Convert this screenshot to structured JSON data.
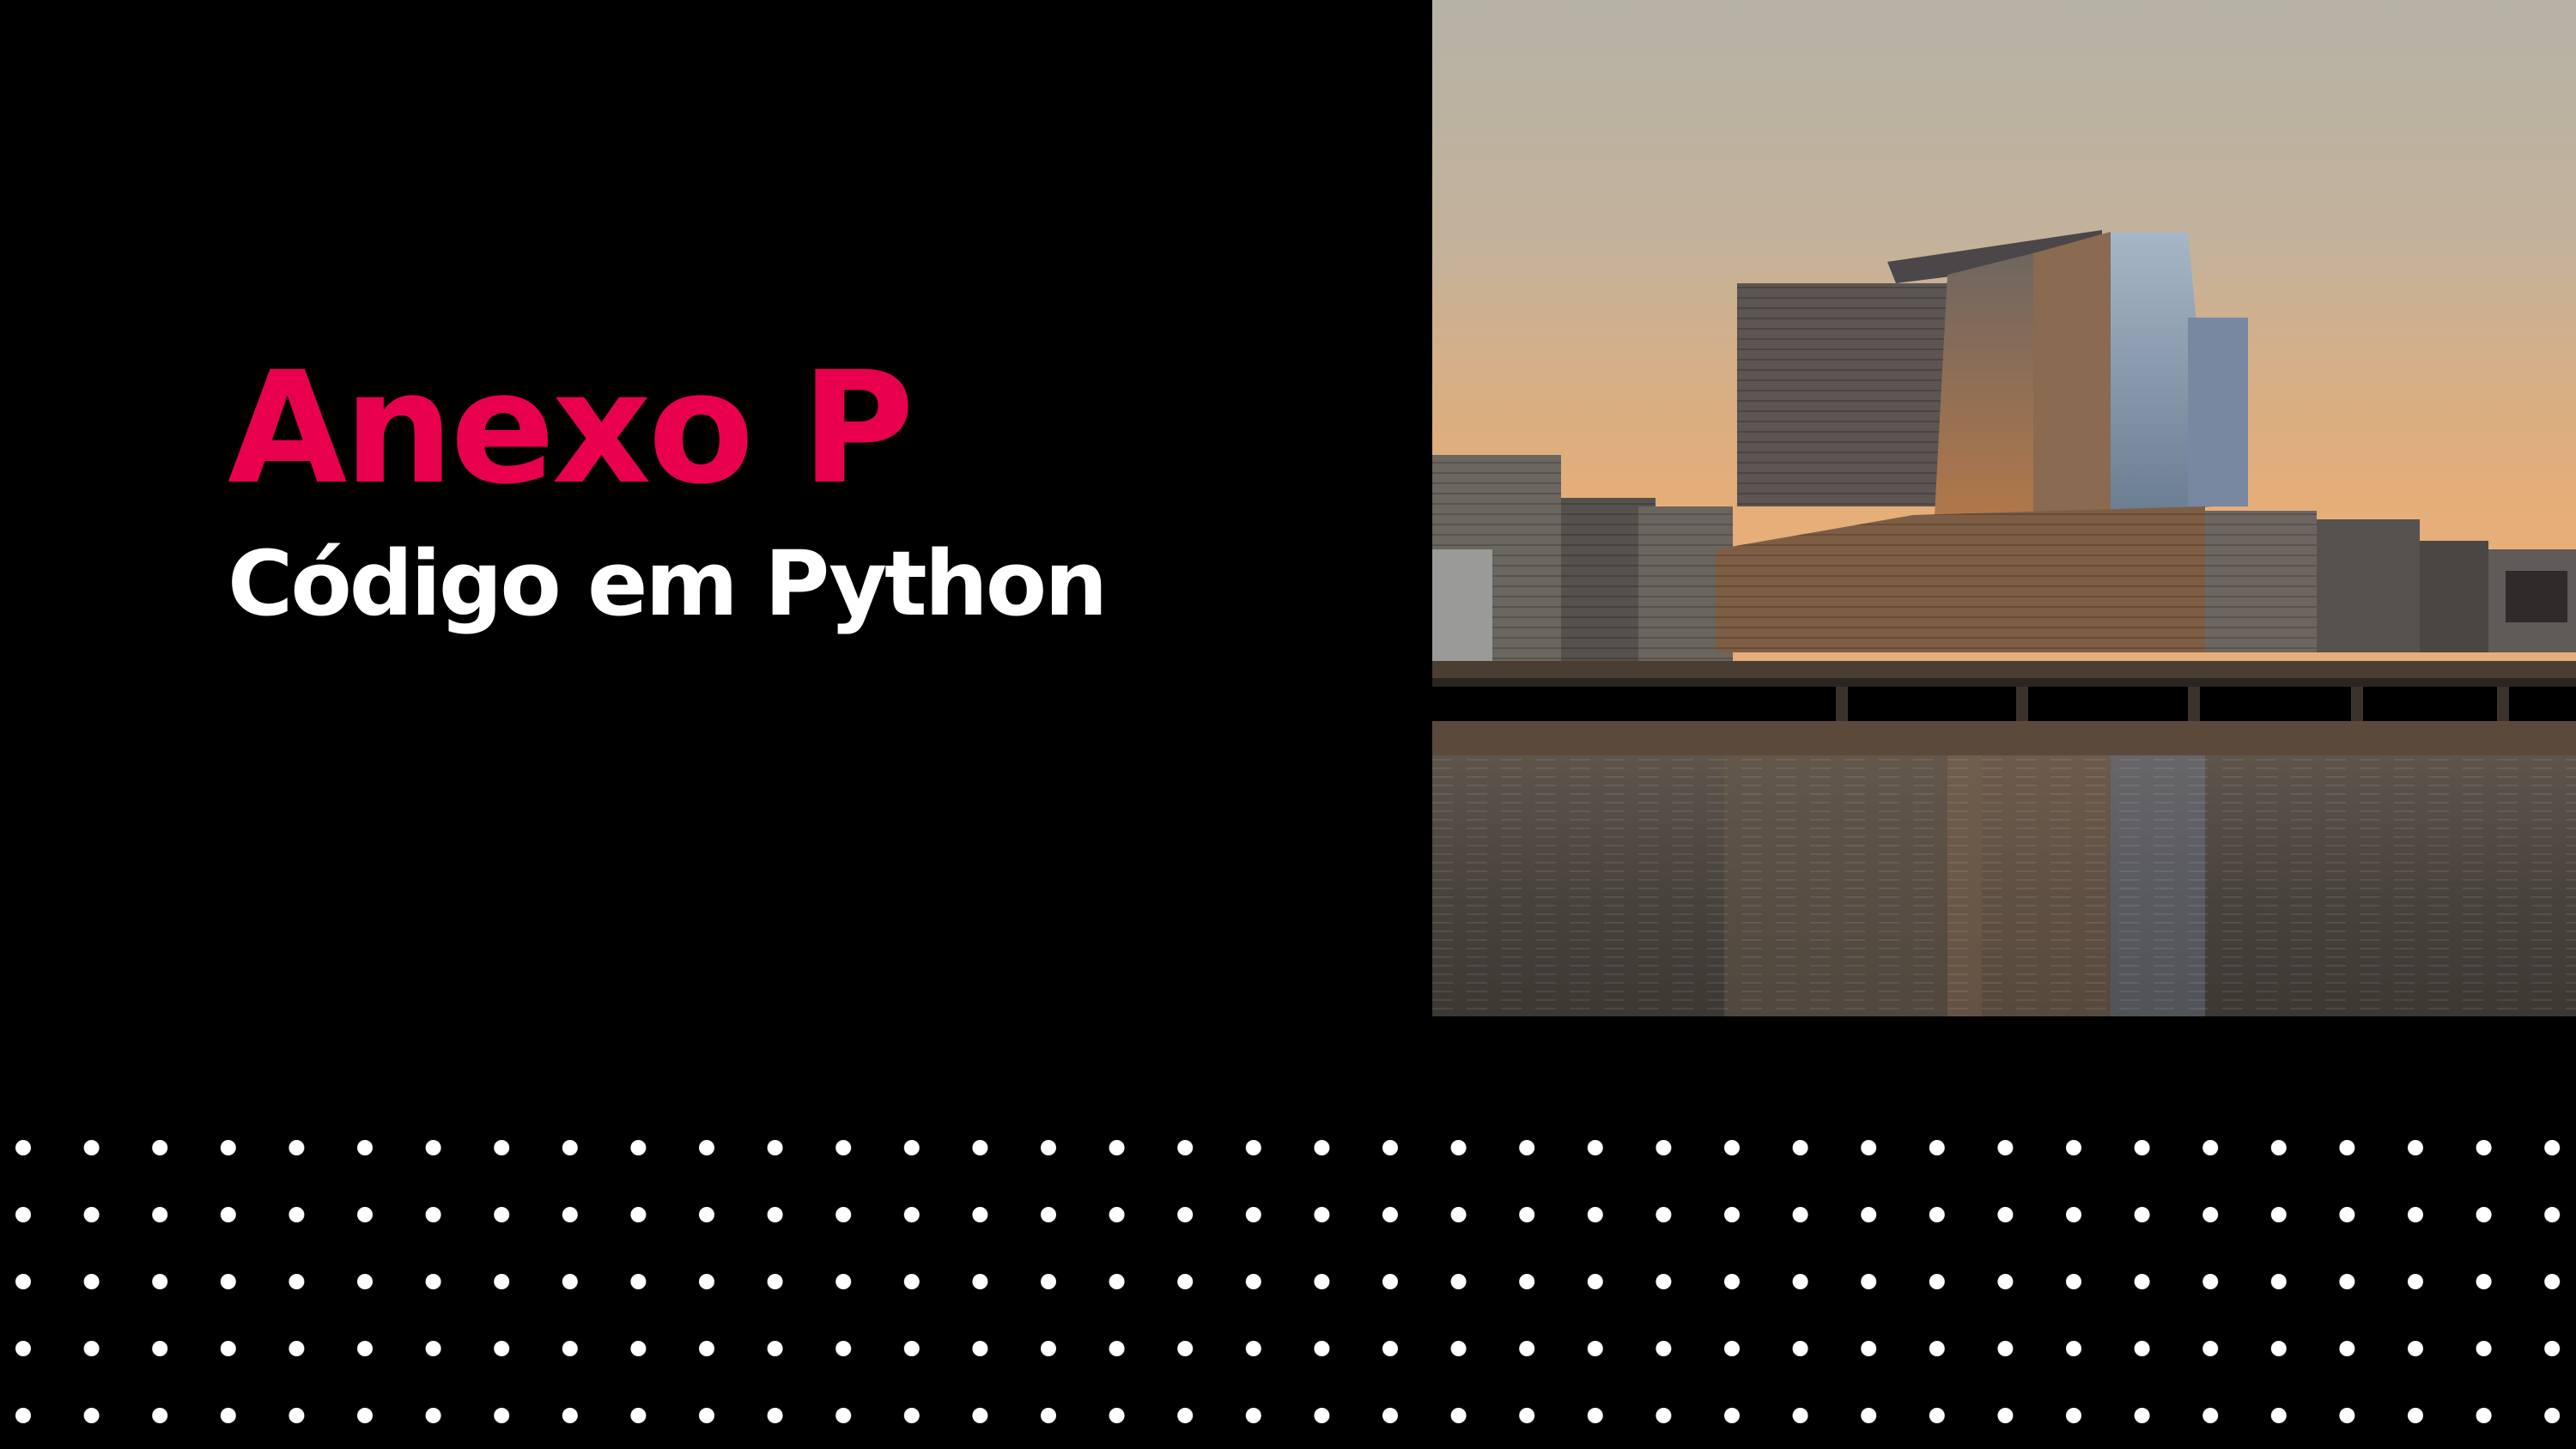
{
  "slide": {
    "title": "Anexo P",
    "subtitle": "Código em Python"
  },
  "colors": {
    "background": "#000000",
    "title": "#E8004F",
    "subtitle": "#FFFFFF",
    "dots": "#FFFFFF"
  },
  "photo": {
    "icon": "city-waterfront-photo"
  }
}
